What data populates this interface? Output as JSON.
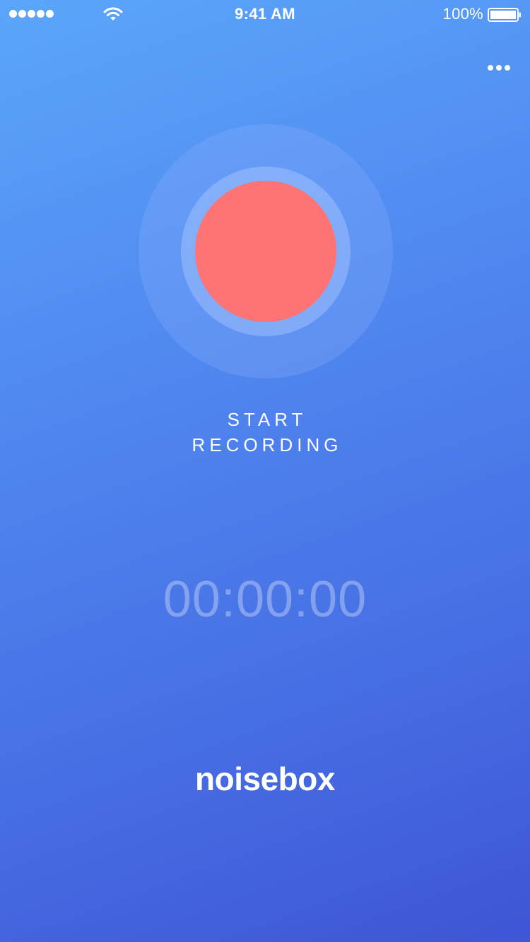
{
  "status_bar": {
    "time": "9:41 AM",
    "battery_percent": "100%",
    "signal_icon": "signal-dots-icon",
    "wifi_icon": "wifi-icon",
    "battery_icon": "battery-icon"
  },
  "menu": {
    "more_icon": "more-horizontal-icon"
  },
  "recorder": {
    "button_icon": "record-icon",
    "button_color": "#fe7373",
    "label_line1": "START",
    "label_line2": "RECORDING",
    "timer": "00:00:00"
  },
  "brand": {
    "name": "noisebox"
  },
  "colors": {
    "background_top": "#5ba6fb",
    "background_bottom": "#3e55d6",
    "record": "#fe7373"
  }
}
